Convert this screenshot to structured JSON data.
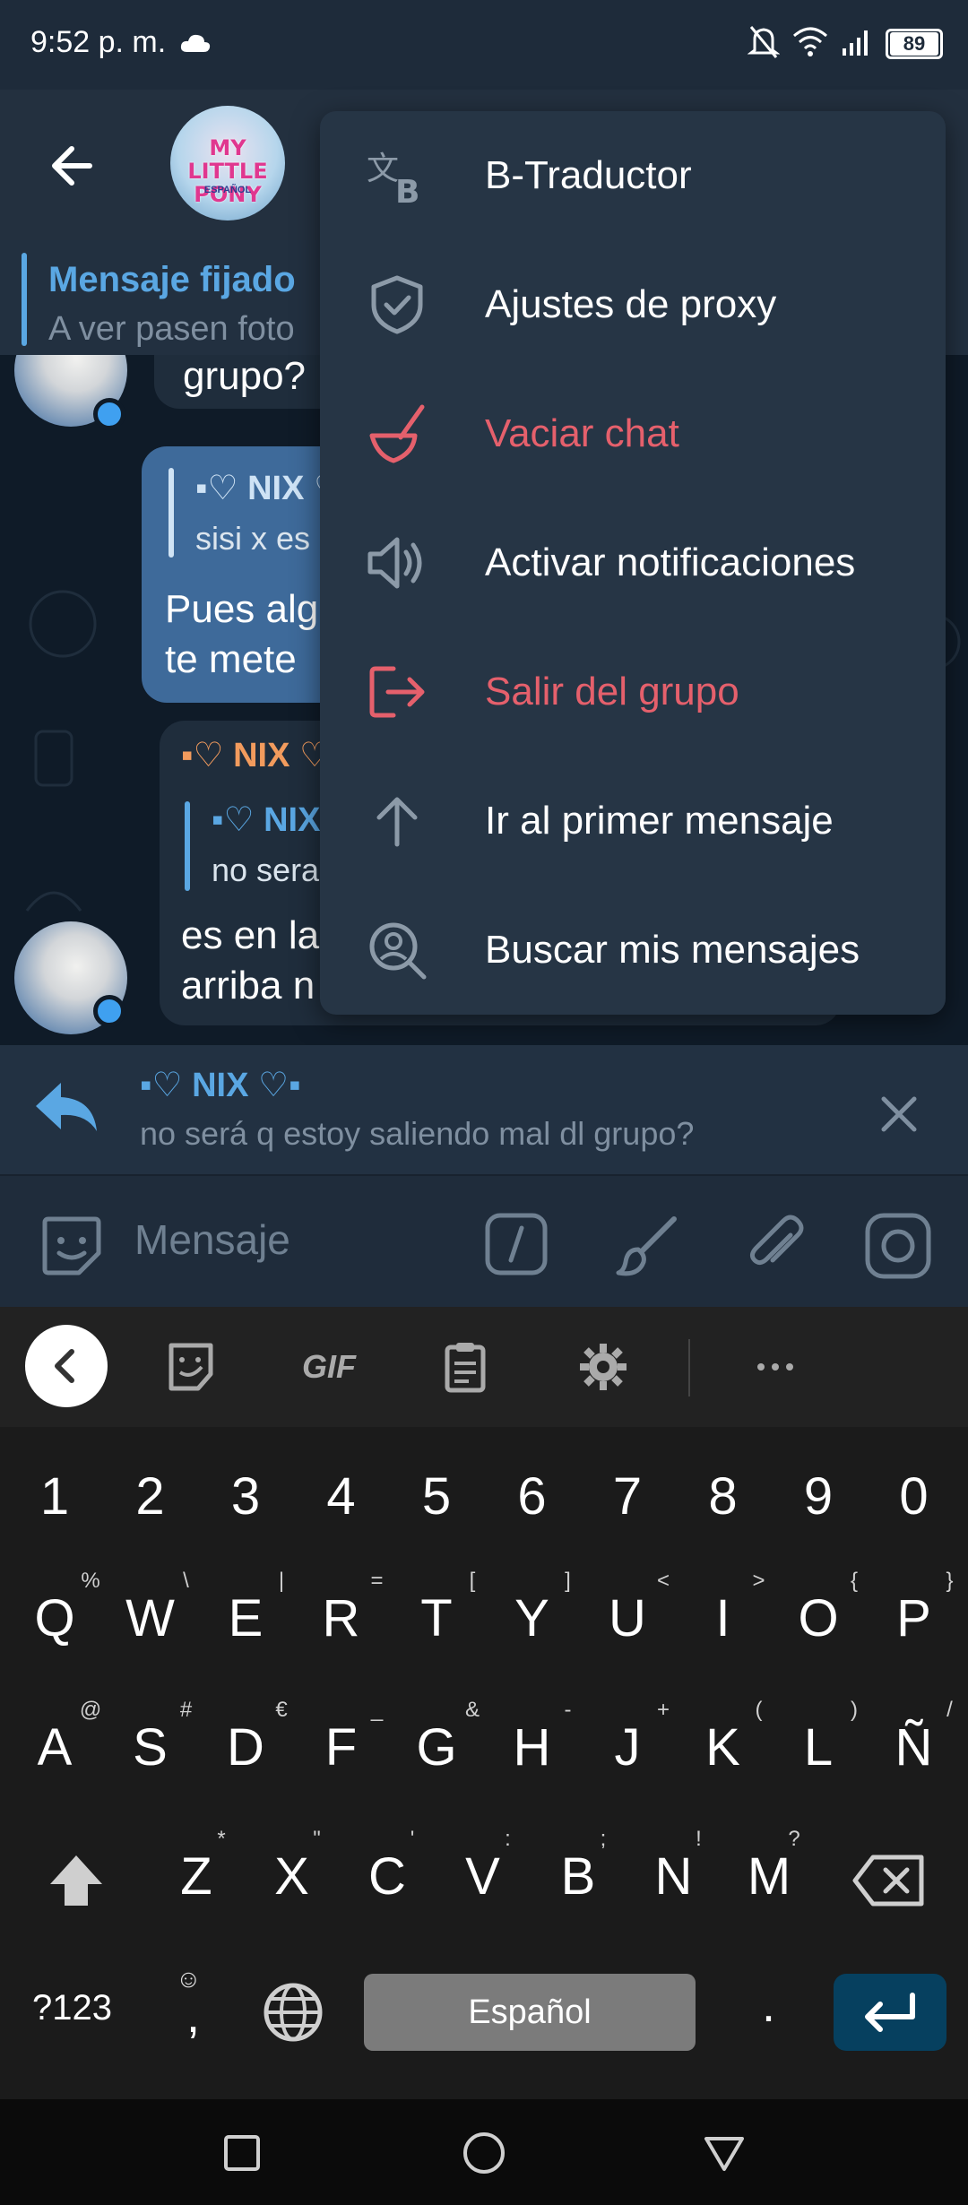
{
  "status_bar": {
    "time": "9:52 p. m.",
    "battery": "89"
  },
  "header": {
    "avatar_text": "MY LITTLE PONY",
    "avatar_subtext": "ESPAÑOL"
  },
  "pinned": {
    "title": "Mensaje fijado",
    "text": "A ver pasen foto"
  },
  "chat": {
    "messages": [
      {
        "text": "grupo?"
      },
      {
        "quote_name": "▪♡ NIX ♡",
        "quote_text": "sisi x es",
        "line1": "Pues alg",
        "line2": "te mete"
      },
      {
        "sender": "▪♡ NIX ♡",
        "quote_name": "▪♡ NIX",
        "quote_text": "no sera",
        "line1": "es en la",
        "line2": "arriba n"
      }
    ]
  },
  "menu": {
    "items": [
      {
        "label": "B-Traductor",
        "icon": "translate-icon",
        "danger": false
      },
      {
        "label": "Ajustes de proxy",
        "icon": "shield-icon",
        "danger": false
      },
      {
        "label": "Vaciar chat",
        "icon": "broom-icon",
        "danger": true
      },
      {
        "label": "Activar notificaciones",
        "icon": "speaker-icon",
        "danger": false
      },
      {
        "label": "Salir del grupo",
        "icon": "exit-icon",
        "danger": true
      },
      {
        "label": "Ir al primer mensaje",
        "icon": "arrow-up-icon",
        "danger": false
      },
      {
        "label": "Buscar mis mensajes",
        "icon": "user-search-icon",
        "danger": false
      }
    ]
  },
  "reply": {
    "name": "▪♡ NIX ♡▪",
    "text": "no será q estoy saliendo mal dl grupo?"
  },
  "input": {
    "placeholder": "Mensaje"
  },
  "keyboard": {
    "toolbar_gif": "GIF",
    "row_numbers": [
      "1",
      "2",
      "3",
      "4",
      "5",
      "6",
      "7",
      "8",
      "9",
      "0"
    ],
    "row1": [
      "Q",
      "W",
      "E",
      "R",
      "T",
      "Y",
      "U",
      "I",
      "O",
      "P"
    ],
    "row1_hints": [
      "%",
      "\\",
      "|",
      "=",
      "[",
      "]",
      "<",
      ">",
      "{",
      "}"
    ],
    "row2": [
      "A",
      "S",
      "D",
      "F",
      "G",
      "H",
      "J",
      "K",
      "L",
      "Ñ"
    ],
    "row2_hints": [
      "@",
      "#",
      "€",
      "_",
      "&",
      "-",
      "+",
      "(",
      ")",
      "/"
    ],
    "row3": [
      "Z",
      "X",
      "C",
      "V",
      "B",
      "N",
      "M"
    ],
    "row3_hints": [
      "*",
      "\"",
      "'",
      ":",
      ";",
      "!",
      "?"
    ],
    "key_123": "?123",
    "comma": ",",
    "period": ".",
    "space_label": "Español"
  },
  "colors": {
    "accent": "#5aa7e3",
    "danger": "#e5606c",
    "menu_bg": "#263545",
    "enter_key": "#06405f"
  }
}
